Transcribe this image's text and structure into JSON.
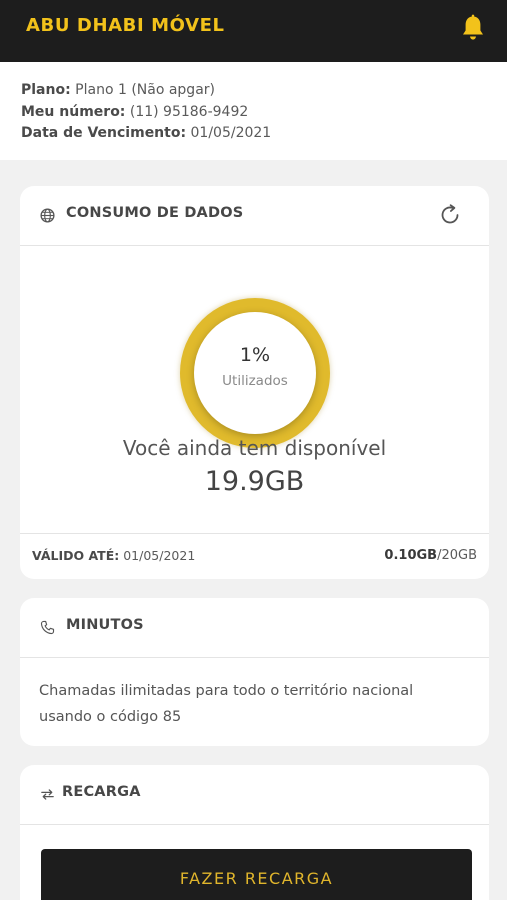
{
  "header": {
    "app_title": "ABU DHABI MÓVEL",
    "icons": {
      "notifications": "bell-icon"
    },
    "accent_color": "#f2c21b"
  },
  "plan_info": {
    "plan_label": "Plano:",
    "plan_value": "Plano 1 (Não apgar)",
    "number_label": "Meu número:",
    "number_value": "(11) 95186-9492",
    "due_label": "Data de Vencimento:",
    "due_value": "01/05/2021"
  },
  "data_usage": {
    "title": "CONSUMO DE DADOS",
    "icons": {
      "title": "globe-icon",
      "action": "refresh-icon"
    },
    "percent_used": "1%",
    "percent_label": "Utilizados",
    "used_fraction": 0.01,
    "available_text": "Você ainda tem disponível",
    "available_amount": "19.9GB",
    "valid_label": "VÁLIDO ATÉ:",
    "valid_value": "01/05/2021",
    "used_amount": "0.10GB",
    "total_amount": "/20GB"
  },
  "minutes": {
    "title": "MINUTOS",
    "icon": "phone-icon",
    "description": "Chamadas ilimitadas para todo o território nacional usando o código 85"
  },
  "recharge": {
    "title": "RECARGA",
    "icon": "swap-arrows-icon",
    "button_label": "FAZER RECARGA"
  }
}
